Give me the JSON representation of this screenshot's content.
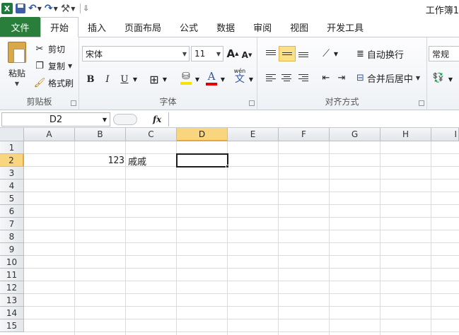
{
  "app": {
    "title": "工作簿1"
  },
  "tabs": [
    {
      "label": "文件"
    },
    {
      "label": "开始"
    },
    {
      "label": "插入"
    },
    {
      "label": "页面布局"
    },
    {
      "label": "公式"
    },
    {
      "label": "数据"
    },
    {
      "label": "审阅"
    },
    {
      "label": "视图"
    },
    {
      "label": "开发工具"
    }
  ],
  "clipboard": {
    "group": "剪贴板",
    "paste": "粘贴",
    "cut": "剪切",
    "copy": "复制",
    "format_painter": "格式刷"
  },
  "font": {
    "group": "字体",
    "name": "宋体",
    "size": "11",
    "bold": "B",
    "italic": "I",
    "underline": "U",
    "font_color_glyph": "A",
    "grow": "A",
    "shrink": "A",
    "phonetic": "wén"
  },
  "alignment": {
    "group": "对齐方式",
    "wrap_text": "自动换行",
    "merge_center": "合并后居中"
  },
  "number": {
    "format": "常规"
  },
  "formula_bar": {
    "name_box": "D2",
    "fx": "fx",
    "value": ""
  },
  "grid": {
    "columns": [
      "A",
      "B",
      "C",
      "D",
      "E",
      "F",
      "G",
      "H",
      "I"
    ],
    "rows": [
      "1",
      "2",
      "3",
      "4",
      "5",
      "6",
      "7",
      "8",
      "9",
      "10",
      "11",
      "12",
      "13",
      "14",
      "15"
    ],
    "selected_column": "D",
    "selected_row": "2",
    "cells": {
      "B2": "123",
      "C2": "戚戚"
    }
  },
  "colors": {
    "file_tab": "#2a7e3b",
    "selection": "#f8d57e",
    "highlight": "#fbe08a"
  }
}
